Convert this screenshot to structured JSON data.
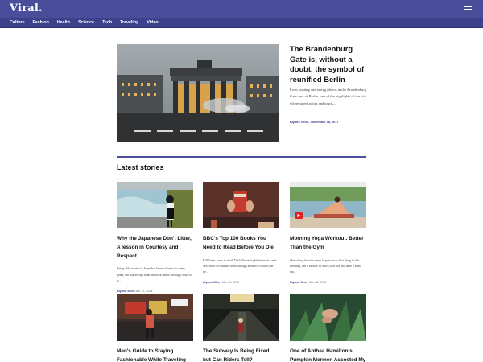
{
  "header": {
    "logo": "Viral.",
    "menu_icon": "hamburger-menu-icon"
  },
  "nav": {
    "items": [
      "Culture",
      "Fashion",
      "Health",
      "Science",
      "Tech",
      "Traveling",
      "Video"
    ]
  },
  "featured": {
    "title": "The Brandenburg Gate is, without a doubt, the symbol of reunified Berlin",
    "excerpt": "I was visiting and taking photos in the Brandenburg Gate area of Berlin, one of the highlights of the city where street artists and touris...",
    "author": "Biyano Viho",
    "date": "November 18, 2017"
  },
  "latest": {
    "heading": "Latest stories",
    "stories": [
      {
        "title": "Why the Japanese Don't Litter, A lesson in Courtesy and Respect",
        "excerpt": "Being able to visit in Japan has been a dream for many years, but has always been put back due to the high costs of tr...",
        "author": "Biyano Viho",
        "date": "Apr 12, 2018"
      },
      {
        "title": "BBC's Top 100 Books You Need to Read Before You Die",
        "excerpt": "Bill Gates loves to read. The billionaire philanthropist and Microsoft co-founder tears through around 50 books per ye...",
        "author": "Biyano Viho",
        "date": "Mar 31, 2018"
      },
      {
        "title": "Morning Yoga Workout. Better Than the Gym",
        "excerpt": "One of my favorite times to practice is first thing in the morning. I'm a mother of a two year old and have a busy car...",
        "author": "Biyano Viho",
        "date": "Mar 08, 2018"
      },
      {
        "title": "Men's Guide to Staying Fashionable While Traveling",
        "excerpt": "",
        "author": "",
        "date": ""
      },
      {
        "title": "The Subway Is Being Fixed, but Can Riders Tell?",
        "excerpt": "",
        "author": "",
        "date": ""
      },
      {
        "title": "One of Anthea Hamilton's Pumpkin Mermen Accosted My Boyfriend at the Tate",
        "excerpt": "",
        "author": "",
        "date": ""
      }
    ]
  },
  "colors": {
    "header_bg": "#4a4e9a",
    "nav_bg": "#3c418c",
    "accent": "#3c418c"
  }
}
